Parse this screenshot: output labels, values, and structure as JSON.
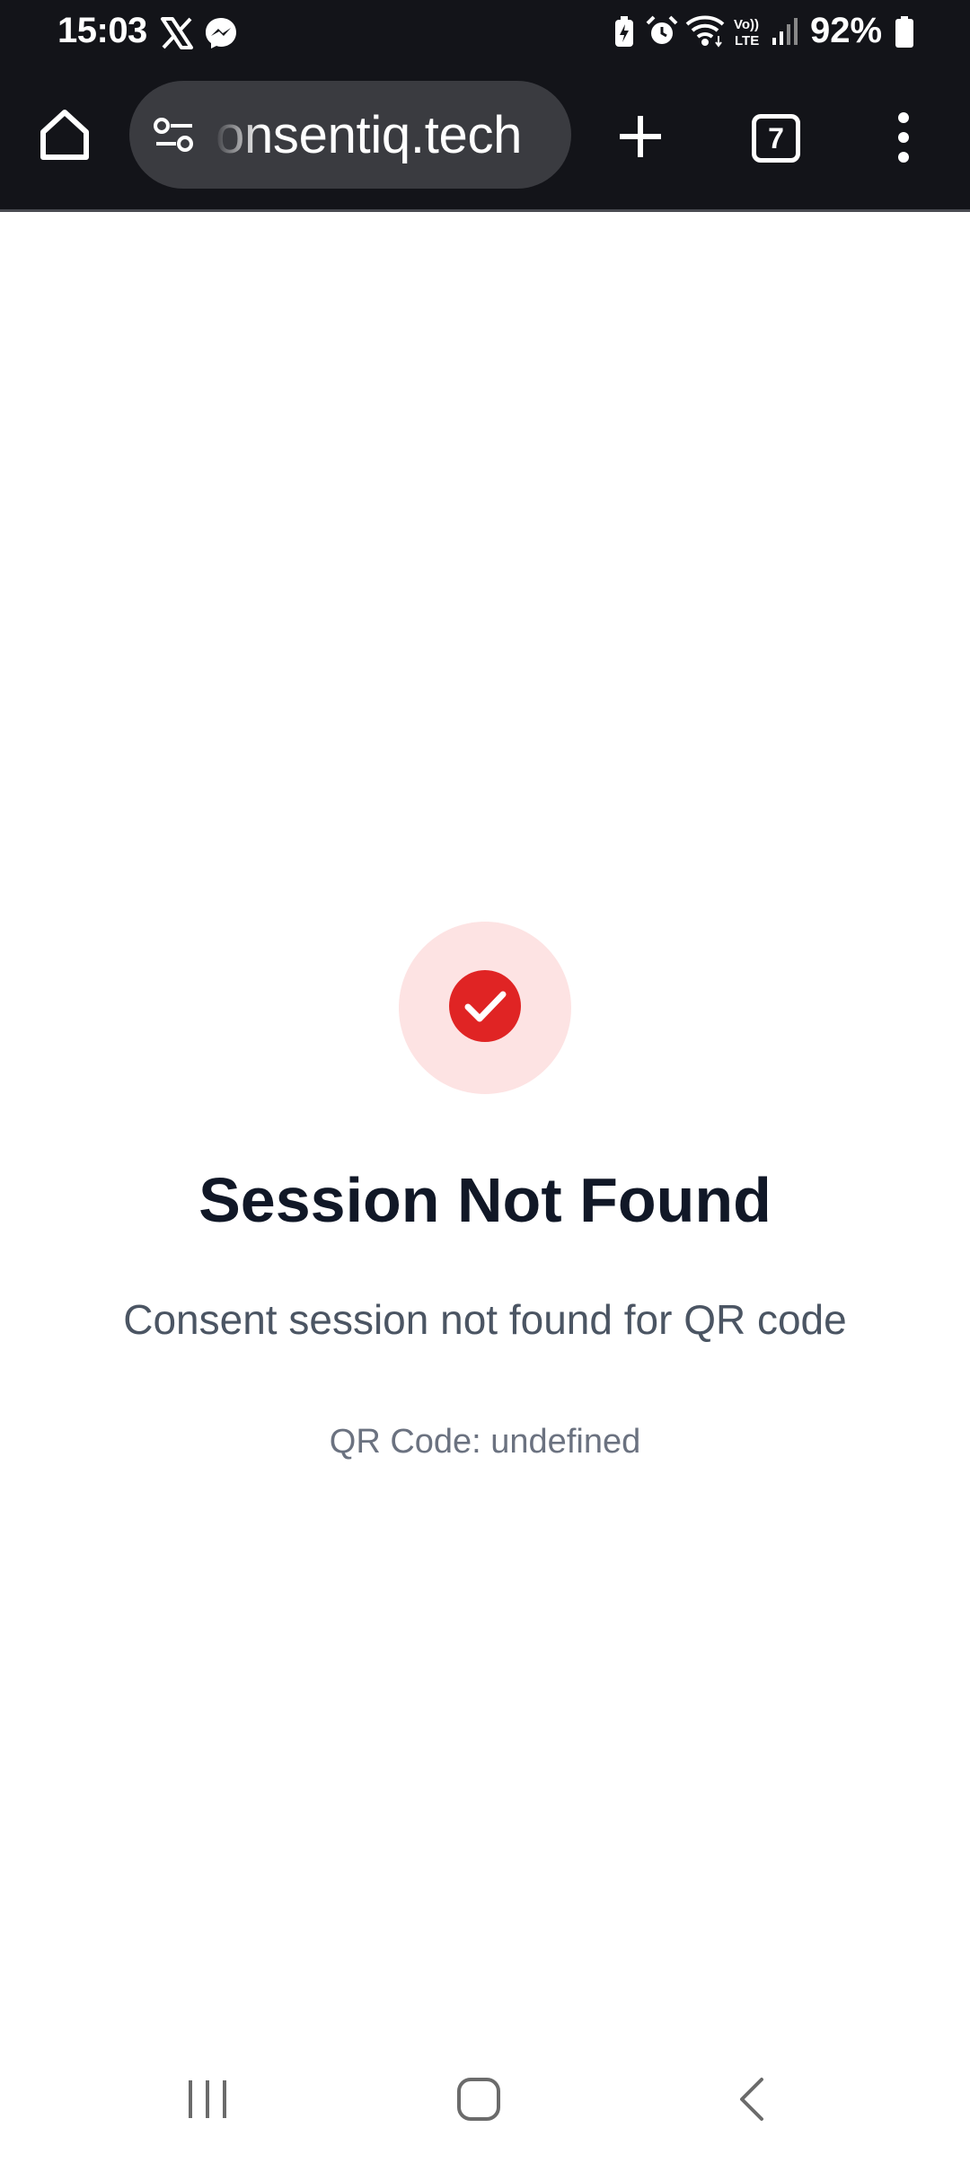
{
  "status_bar": {
    "time": "15:03",
    "battery": "92%",
    "left_icons": [
      "x-app-icon",
      "messenger-icon"
    ],
    "right_icons": [
      "battery-saver-icon",
      "alarm-icon",
      "wifi-icon",
      "volte-icon",
      "signal-icon",
      "battery-icon"
    ]
  },
  "browser": {
    "url": "onsentiq.tech",
    "tab_count": "7"
  },
  "page": {
    "title": "Session Not Found",
    "message": "Consent session not found for QR code",
    "qr_line": "QR Code: undefined"
  },
  "colors": {
    "chrome_bg": "#131419",
    "url_pill_bg": "#3a3b40",
    "status_circle_bg": "#fde3e3",
    "status_icon": "#e02424",
    "title_text": "#111827",
    "body_text": "#4b5563"
  }
}
